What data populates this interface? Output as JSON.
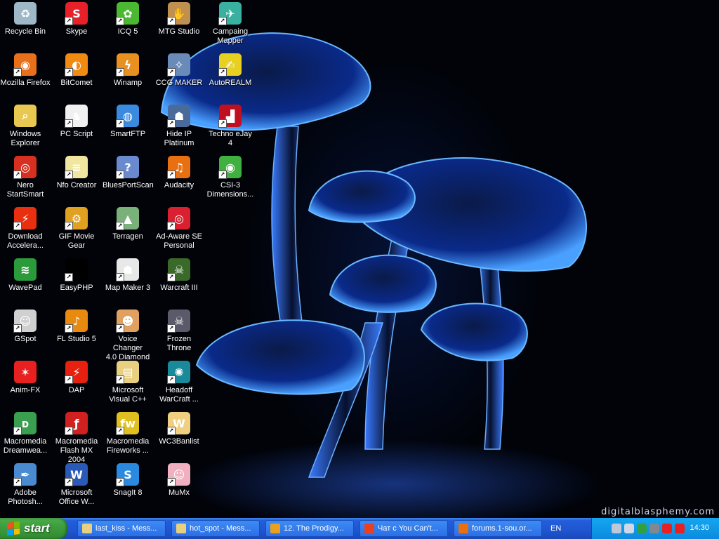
{
  "desktop": {
    "credit": "digitalblasphemy.com",
    "icons": [
      {
        "id": "recycle-bin",
        "label": "Recycle Bin",
        "col": 0,
        "row": 0,
        "color": "#9fb8c8",
        "glyph": "♻",
        "shortcut": false
      },
      {
        "id": "mozilla-firefox",
        "label": "Mozilla Firefox",
        "col": 0,
        "row": 1,
        "color": "#e8701a",
        "glyph": "◉",
        "shortcut": true
      },
      {
        "id": "windows-explorer",
        "label": "Windows\nExplorer",
        "col": 0,
        "row": 2,
        "color": "#e8c850",
        "glyph": "⌕",
        "shortcut": false
      },
      {
        "id": "nero-startsmart",
        "label": "Nero\nStartSmart",
        "col": 0,
        "row": 3,
        "color": "#d83020",
        "glyph": "◎",
        "shortcut": true
      },
      {
        "id": "download-accelerator",
        "label": "Download\nAccelera...",
        "col": 0,
        "row": 4,
        "color": "#e83010",
        "glyph": "⚡",
        "shortcut": true
      },
      {
        "id": "wavepad",
        "label": "WavePad",
        "col": 0,
        "row": 5,
        "color": "#2a9a3a",
        "glyph": "≋",
        "shortcut": false
      },
      {
        "id": "gspot",
        "label": "GSpot",
        "col": 0,
        "row": 6,
        "color": "#d0d0d0",
        "glyph": "☺",
        "shortcut": true
      },
      {
        "id": "anim-fx",
        "label": "Anim-FX",
        "col": 0,
        "row": 7,
        "color": "#e82020",
        "glyph": "✶",
        "shortcut": false
      },
      {
        "id": "macromedia-dreamweaver",
        "label": "Macromedia\nDreamwea...",
        "col": 0,
        "row": 8,
        "color": "#3aa050",
        "glyph": "ᴅ",
        "shortcut": true
      },
      {
        "id": "adobe-photoshop",
        "label": "Adobe\nPhotosh...",
        "col": 0,
        "row": 9,
        "color": "#4a8ad0",
        "glyph": "✒",
        "shortcut": true
      },
      {
        "id": "skype",
        "label": "Skype",
        "col": 1,
        "row": 0,
        "color": "#e8202a",
        "glyph": "S",
        "shortcut": true
      },
      {
        "id": "bitcomet",
        "label": "BitComet",
        "col": 1,
        "row": 1,
        "color": "#f08a10",
        "glyph": "◐",
        "shortcut": true
      },
      {
        "id": "pc-script",
        "label": "PC Script",
        "col": 1,
        "row": 2,
        "color": "#f0f0f0",
        "glyph": "♞",
        "shortcut": true
      },
      {
        "id": "nfo-creator",
        "label": "Nfo Creator",
        "col": 1,
        "row": 3,
        "color": "#f0e6a0",
        "glyph": "≡",
        "shortcut": true
      },
      {
        "id": "gif-movie-gear",
        "label": "GIF Movie\nGear",
        "col": 1,
        "row": 4,
        "color": "#e0a020",
        "glyph": "⚙",
        "shortcut": true
      },
      {
        "id": "easyphp",
        "label": "EasyPHP",
        "col": 1,
        "row": 5,
        "color": "#000000",
        "glyph": "",
        "shortcut": true
      },
      {
        "id": "fl-studio-5",
        "label": "FL Studio 5",
        "col": 1,
        "row": 6,
        "color": "#e88a10",
        "glyph": "♪",
        "shortcut": true
      },
      {
        "id": "dap",
        "label": "DAP",
        "col": 1,
        "row": 7,
        "color": "#e82010",
        "glyph": "⚡",
        "shortcut": true
      },
      {
        "id": "macromedia-flash",
        "label": "Macromedia\nFlash MX 2004",
        "col": 1,
        "row": 8,
        "color": "#d02020",
        "glyph": "ƒ",
        "shortcut": true
      },
      {
        "id": "microsoft-office-word",
        "label": "Microsoft\nOffice W...",
        "col": 1,
        "row": 9,
        "color": "#2a5ab8",
        "glyph": "W",
        "shortcut": true
      },
      {
        "id": "icq-5",
        "label": "ICQ 5",
        "col": 2,
        "row": 0,
        "color": "#4ab830",
        "glyph": "✿",
        "shortcut": true
      },
      {
        "id": "winamp",
        "label": "Winamp",
        "col": 2,
        "row": 1,
        "color": "#e89020",
        "glyph": "ϟ",
        "shortcut": true
      },
      {
        "id": "smartftp",
        "label": "SmartFTP",
        "col": 2,
        "row": 2,
        "color": "#3a8ae0",
        "glyph": "◍",
        "shortcut": true
      },
      {
        "id": "bluesportscan",
        "label": "BluesPortScan",
        "col": 2,
        "row": 3,
        "color": "#6a8ad0",
        "glyph": "?",
        "shortcut": true
      },
      {
        "id": "terragen",
        "label": "Terragen",
        "col": 2,
        "row": 4,
        "color": "#7ab07a",
        "glyph": "▲",
        "shortcut": true
      },
      {
        "id": "map-maker-3",
        "label": "Map Maker 3",
        "col": 2,
        "row": 5,
        "color": "#e8e8e8",
        "glyph": "☗",
        "shortcut": true
      },
      {
        "id": "voice-changer",
        "label": "Voice Changer\n4.0 Diamond",
        "col": 2,
        "row": 6,
        "color": "#e0a060",
        "glyph": "☻",
        "shortcut": true
      },
      {
        "id": "microsoft-visual-cpp",
        "label": "Microsoft\nVisual C++",
        "col": 2,
        "row": 7,
        "color": "#e8d080",
        "glyph": "▤",
        "shortcut": true
      },
      {
        "id": "macromedia-fireworks",
        "label": "Macromedia\nFireworks ...",
        "col": 2,
        "row": 8,
        "color": "#e0c020",
        "glyph": "fw",
        "shortcut": true
      },
      {
        "id": "snagit-8",
        "label": "SnagIt 8",
        "col": 2,
        "row": 9,
        "color": "#2a8ae0",
        "glyph": "S",
        "shortcut": true
      },
      {
        "id": "mtg-studio",
        "label": "MTG Studio",
        "col": 3,
        "row": 0,
        "color": "#c09050",
        "glyph": "✋",
        "shortcut": true
      },
      {
        "id": "ccg-maker",
        "label": "CCG MAKER",
        "col": 3,
        "row": 1,
        "color": "#6a8ab8",
        "glyph": "✧",
        "shortcut": true
      },
      {
        "id": "hide-ip-platinum",
        "label": "Hide IP\nPlatinum",
        "col": 3,
        "row": 2,
        "color": "#4a6a9a",
        "glyph": "☗",
        "shortcut": true
      },
      {
        "id": "audacity",
        "label": "Audacity",
        "col": 3,
        "row": 3,
        "color": "#e87010",
        "glyph": "♫",
        "shortcut": true
      },
      {
        "id": "ad-aware-se",
        "label": "Ad-Aware SE\nPersonal",
        "col": 3,
        "row": 4,
        "color": "#d82030",
        "glyph": "◎",
        "shortcut": true
      },
      {
        "id": "warcraft-iii",
        "label": "Warcraft III",
        "col": 3,
        "row": 5,
        "color": "#3a6a2a",
        "glyph": "☠",
        "shortcut": true
      },
      {
        "id": "frozen-throne",
        "label": "Frozen\nThrone",
        "col": 3,
        "row": 6,
        "color": "#5a5a6a",
        "glyph": "☠",
        "shortcut": true
      },
      {
        "id": "headoff-warcraft",
        "label": "Headoff\nWarCraft ...",
        "col": 3,
        "row": 7,
        "color": "#1a8a9a",
        "glyph": "✺",
        "shortcut": true
      },
      {
        "id": "wc3banlist",
        "label": "WC3Banlist",
        "col": 3,
        "row": 8,
        "color": "#f0d080",
        "glyph": "W",
        "shortcut": true
      },
      {
        "id": "mumx",
        "label": "MuMx",
        "col": 3,
        "row": 9,
        "color": "#f0b0c0",
        "glyph": "☺",
        "shortcut": true
      },
      {
        "id": "campaing-mapper",
        "label": "Campaing\nMapper",
        "col": 4,
        "row": 0,
        "color": "#3ab0a0",
        "glyph": "✈",
        "shortcut": true
      },
      {
        "id": "autorealm",
        "label": "AutoREALM",
        "col": 4,
        "row": 1,
        "color": "#e8d020",
        "glyph": "✍",
        "shortcut": true
      },
      {
        "id": "techno-ejay-4",
        "label": "Techno eJay\n4",
        "col": 4,
        "row": 2,
        "color": "#c01020",
        "glyph": "▟",
        "shortcut": true
      },
      {
        "id": "csi-3-dimensions",
        "label": "CSI-3\nDimensions...",
        "col": 4,
        "row": 3,
        "color": "#40b040",
        "glyph": "◉",
        "shortcut": true
      }
    ]
  },
  "taskbar": {
    "start_label": "start",
    "tasks": [
      {
        "id": "last-kiss",
        "label": "last_kiss - Mess...",
        "color": "#e8d080"
      },
      {
        "id": "hot-spot",
        "label": "hot_spot - Mess...",
        "color": "#e8d080"
      },
      {
        "id": "the-prodigy",
        "label": "12. The Prodigy...",
        "color": "#e8a020"
      },
      {
        "id": "chat",
        "label": "Чат с You Can't...",
        "color": "#e84020"
      },
      {
        "id": "forums",
        "label": "forums.1-sou.or...",
        "color": "#e87010"
      }
    ],
    "language": "EN",
    "tray_icons": [
      {
        "id": "shield",
        "color": "#c0c8d8"
      },
      {
        "id": "network",
        "color": "#d0d8e8"
      },
      {
        "id": "eye",
        "color": "#30a040"
      },
      {
        "id": "volume",
        "color": "#808890"
      },
      {
        "id": "k-app",
        "color": "#e82020"
      },
      {
        "id": "antivirus",
        "color": "#e82020"
      }
    ],
    "clock": "14:30"
  }
}
